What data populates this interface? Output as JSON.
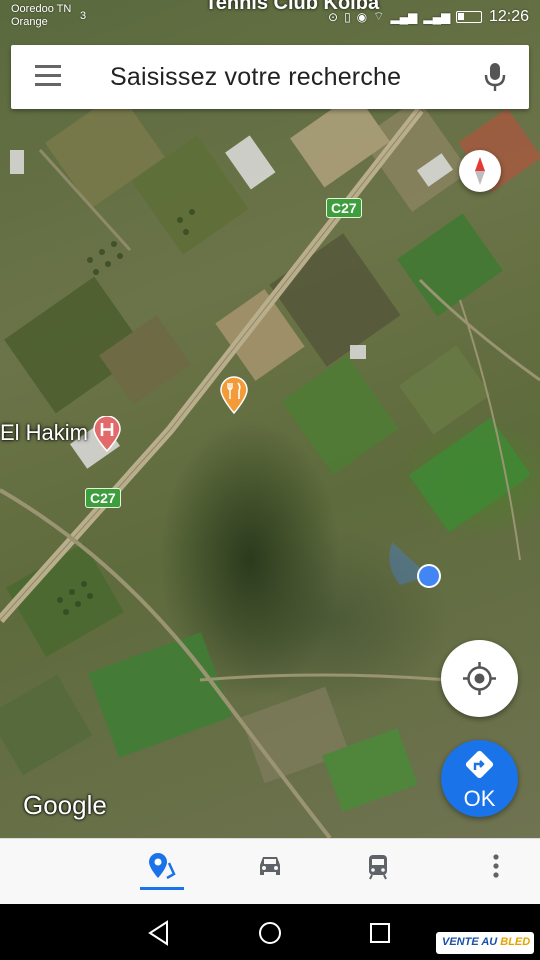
{
  "status_bar": {
    "carrier_line1": "Ooredoo TN",
    "carrier_line2": "Orange",
    "sim_indicator": "3",
    "time": "12:26",
    "top_overflow_label": "Tennis Club Koiba"
  },
  "search": {
    "placeholder": "Saisissez votre recherche",
    "menu_icon": "hamburger-menu-icon",
    "mic_icon": "microphone-icon"
  },
  "map": {
    "road_shields": [
      "C27",
      "C27"
    ],
    "poi_hospital_label": "El Hakim",
    "attribution": "Google",
    "layer": "satellite"
  },
  "controls": {
    "compass_icon": "compass-icon",
    "locate_icon": "my-location-icon",
    "go_label": "OK",
    "go_icon": "directions-icon"
  },
  "bottom_tabs": [
    {
      "name": "explore",
      "icon": "explore-pin-icon",
      "active": true
    },
    {
      "name": "driving",
      "icon": "car-icon",
      "active": false
    },
    {
      "name": "transit",
      "icon": "train-icon",
      "active": false
    },
    {
      "name": "more",
      "icon": "more-vert-icon",
      "active": false
    }
  ],
  "watermark": {
    "text_part1": "VENTE AU ",
    "text_part2": "BLED"
  },
  "colors": {
    "accent": "#1a73e8",
    "road_shield": "#3c9e3c",
    "location_dot": "#4285f4",
    "restaurant_pin": "#f29b38",
    "hospital_pin": "#e36a6a"
  }
}
